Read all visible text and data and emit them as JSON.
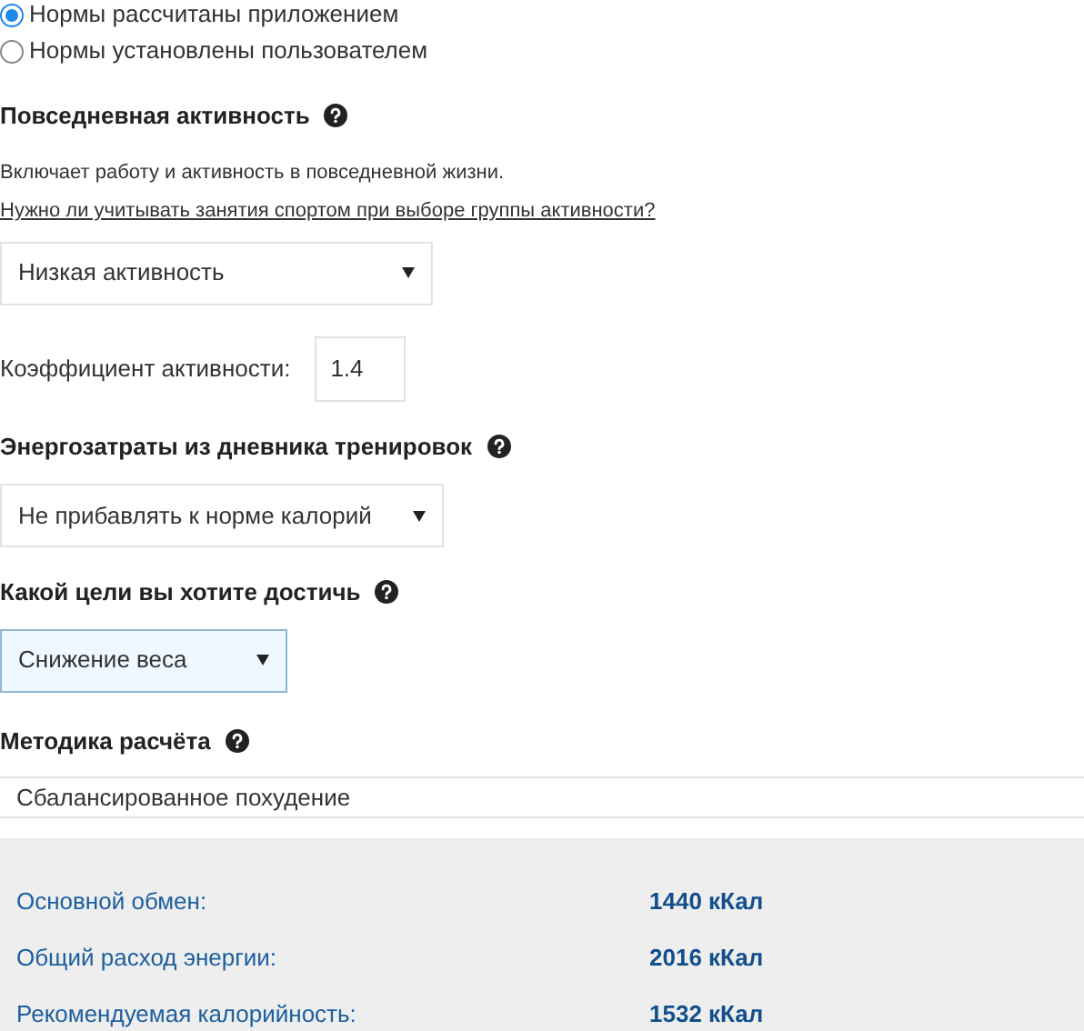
{
  "norms_options": [
    {
      "label": "Нормы рассчитаны приложением",
      "selected": true
    },
    {
      "label": "Нормы установлены пользователем",
      "selected": false
    }
  ],
  "daily_activity": {
    "heading": "Повседневная активность",
    "description": "Включает работу и активность в повседневной жизни.",
    "link": "Нужно ли учитывать занятия спортом при выборе группы активности?",
    "select": "Низкая активность",
    "coefficient_label": "Коэффициент активности:",
    "coefficient_value": "1.4"
  },
  "training_energy": {
    "heading": "Энергозатраты из дневника тренировок",
    "select": "Не прибавлять к норме калорий"
  },
  "goal": {
    "heading": "Какой цели вы хотите достичь",
    "select": "Снижение веса",
    "focused": true
  },
  "method": {
    "heading": "Методика расчёта",
    "value": "Сбалансированное похудение"
  },
  "results": [
    {
      "label": "Основной обмен:",
      "value": "1440 кКал"
    },
    {
      "label": "Общий расход энергии:",
      "value": "2016 кКал"
    },
    {
      "label": "Рекомендуемая калорийность:",
      "value": "1532 кКал"
    }
  ]
}
